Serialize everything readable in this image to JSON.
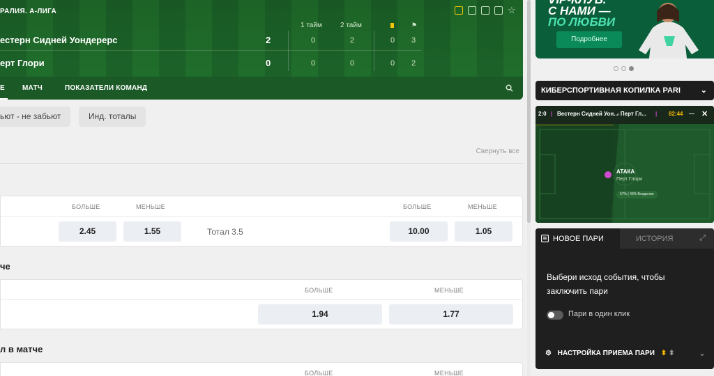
{
  "match": {
    "league": "РАЛИЯ. А-ЛИГА",
    "periods": {
      "first": "1 тайм",
      "second": "2 тайм"
    },
    "team1": {
      "name": "естерн Сидней Уондерерс",
      "score": "2",
      "p1": "0",
      "p2": "2",
      "yellow": "0",
      "corners": "3"
    },
    "team2": {
      "name": "ерт Глори",
      "score": "0",
      "p1": "0",
      "p2": "0",
      "yellow": "0",
      "corners": "2"
    },
    "tabs": [
      "Е",
      "МАТЧ",
      "ПОКАЗАТЕЛИ КОМАНД"
    ],
    "icons": [
      "favorite-icon",
      "stats-icon",
      "field-icon",
      "tv-icon",
      "star-icon"
    ]
  },
  "filters": {
    "chip1": "ьют - не забьют",
    "chip2": "Инд. тоталы"
  },
  "collapse_all": "Свернуть все",
  "market1": {
    "over": "БОЛЬШЕ",
    "under": "МЕНЬШЕ",
    "odd_over_left": "2.45",
    "odd_under_left": "1.55",
    "total_label": "Тотал 3.5",
    "odd_over_right": "10.00",
    "odd_under_right": "1.05"
  },
  "market2": {
    "title": "че",
    "over": "БОЛЬШЕ",
    "under": "МЕНЬШЕ",
    "odd_over": "1.94",
    "odd_under": "1.77"
  },
  "market3": {
    "title": "л в матче",
    "over": "БОЛЬШЕ",
    "under": "МЕНЬШЕ"
  },
  "promo": {
    "line1": "VIP-КЛУБ.",
    "line2": "С НАМИ —",
    "line3": "ПО ЛЮБВИ",
    "button": "Подробнее"
  },
  "bank": {
    "label": "КИБЕРСПОРТИВНАЯ КОПИЛКА PARI"
  },
  "live": {
    "score": "2:0",
    "team1_short": "Вестерн Сидней Уон...",
    "team2_short": "- Перт Гл...",
    "time": "82:44",
    "attack_label": "АТАКА",
    "attack_team": "Перт Глори",
    "possession": "57% | 43% Владение"
  },
  "betslip": {
    "tab_new": "НОВОЕ ПАРИ",
    "tab_history": "ИСТОРИЯ",
    "message": "Выбери исход события, чтобы заключить пари",
    "one_click": "Пари в один клик",
    "settings": "НАСТРОЙКА ПРИЕМА ПАРИ"
  },
  "colors": {
    "brand_green": "#1e6b2c",
    "promo_green": "#0a5f3a",
    "yellow_card": "#f5c400",
    "odds_bg": "#ebeef3"
  }
}
